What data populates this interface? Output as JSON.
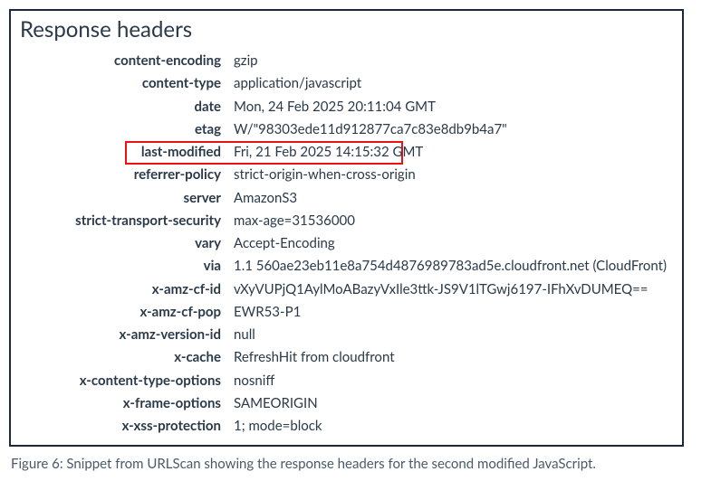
{
  "panel": {
    "title": "Response headers"
  },
  "headers": {
    "content_encoding": {
      "k": "content-encoding",
      "v": "gzip"
    },
    "content_type": {
      "k": "content-type",
      "v": "application/javascript"
    },
    "date": {
      "k": "date",
      "v": "Mon, 24 Feb 2025 20:11:04 GMT"
    },
    "etag": {
      "k": "etag",
      "v": "W/\"98303ede11d912877ca7c83e8db9b4a7\""
    },
    "last_modified": {
      "k": "last-modified",
      "v": "Fri, 21 Feb 2025 14:15:32 GMT"
    },
    "referrer_policy": {
      "k": "referrer-policy",
      "v": "strict-origin-when-cross-origin"
    },
    "server": {
      "k": "server",
      "v": "AmazonS3"
    },
    "strict_transport_security": {
      "k": "strict-transport-security",
      "v": "max-age=31536000"
    },
    "vary": {
      "k": "vary",
      "v": "Accept-Encoding"
    },
    "via": {
      "k": "via",
      "v": "1.1 560ae23eb11e8a754d4876989783ad5e.cloudfront.net (CloudFront)"
    },
    "x_amz_cf_id": {
      "k": "x-amz-cf-id",
      "v": "vXyVUPjQ1AylMoABazyVxIle3ttk-JS9V1lTGwj6197-IFhXvDUMEQ=="
    },
    "x_amz_cf_pop": {
      "k": "x-amz-cf-pop",
      "v": "EWR53-P1"
    },
    "x_amz_version_id": {
      "k": "x-amz-version-id",
      "v": "null"
    },
    "x_cache": {
      "k": "x-cache",
      "v": "RefreshHit from cloudfront"
    },
    "x_content_type_options": {
      "k": "x-content-type-options",
      "v": "nosniff"
    },
    "x_frame_options": {
      "k": "x-frame-options",
      "v": "SAMEORIGIN"
    },
    "x_xss_protection": {
      "k": "x-xss-protection",
      "v": "1; mode=block"
    }
  },
  "caption": "Figure 6: Snippet from URLScan showing the response headers for the second modified JavaScript."
}
